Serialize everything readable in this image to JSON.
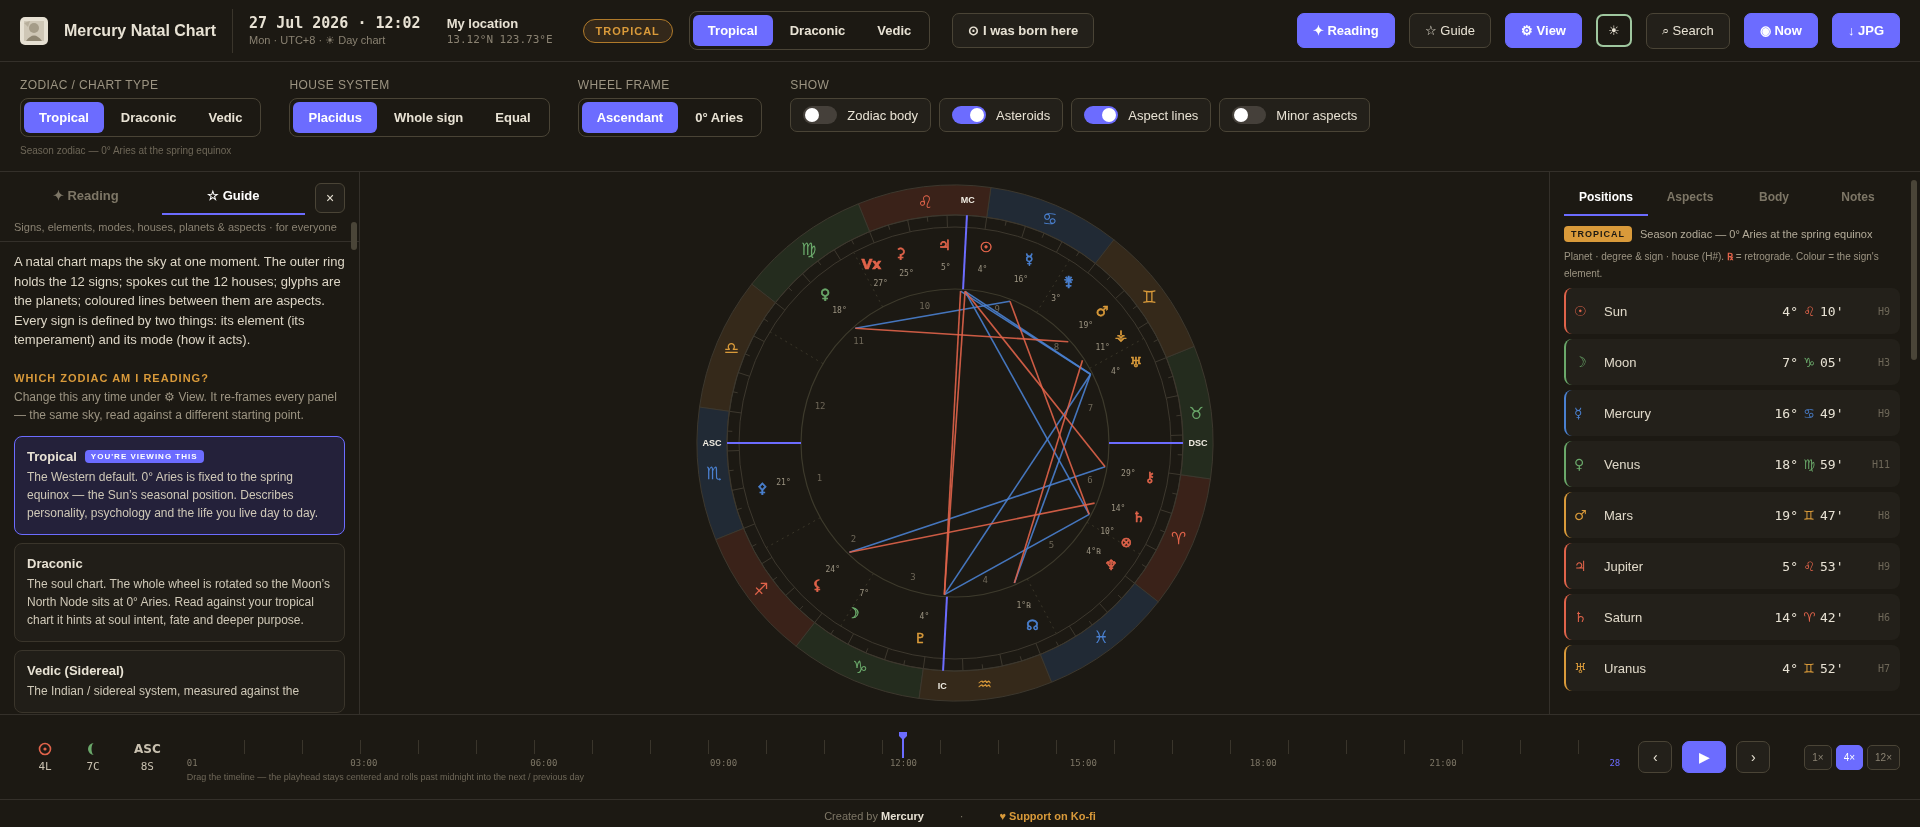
{
  "header": {
    "title": "Mercury Natal Chart",
    "date": "27 Jul 2026 · 12:02",
    "date_sub": "Mon · UTC+8 · ☀ Day chart",
    "location_label": "My location",
    "coords": "13.12°N 123.73°E",
    "zodiac_badge": "TROPICAL",
    "zodiac_tabs": [
      {
        "label": "Tropical",
        "selected": true
      },
      {
        "label": "Draconic",
        "selected": false
      },
      {
        "label": "Vedic",
        "selected": false
      }
    ],
    "born_button": "⊙ I was born here",
    "actions": [
      {
        "label": "✦ Reading",
        "kind": "primary"
      },
      {
        "label": "☆ Guide",
        "kind": "plain"
      },
      {
        "label": "⚙ View",
        "kind": "primary"
      },
      {
        "label": "☀",
        "kind": "theme"
      },
      {
        "label": "⌕ Search",
        "kind": "plain"
      },
      {
        "label": "◉ Now",
        "kind": "primary"
      },
      {
        "label": "↓ JPG",
        "kind": "primary"
      }
    ]
  },
  "settings": {
    "groups": [
      {
        "label": "ZODIAC / CHART TYPE",
        "options": [
          {
            "label": "Tropical",
            "selected": true
          },
          {
            "label": "Draconic",
            "selected": false
          },
          {
            "label": "Vedic",
            "selected": false
          }
        ],
        "note": "Season zodiac — 0° Aries at the spring equinox"
      },
      {
        "label": "HOUSE SYSTEM",
        "options": [
          {
            "label": "Placidus",
            "selected": true
          },
          {
            "label": "Whole sign",
            "selected": false
          },
          {
            "label": "Equal",
            "selected": false
          }
        ]
      },
      {
        "label": "WHEEL FRAME",
        "options": [
          {
            "label": "Ascendant",
            "selected": true
          },
          {
            "label": "0° Aries",
            "selected": false
          }
        ]
      }
    ],
    "show": {
      "label": "SHOW",
      "toggles": [
        {
          "label": "Zodiac body",
          "on": false
        },
        {
          "label": "Asteroids",
          "on": true
        },
        {
          "label": "Aspect lines",
          "on": true
        },
        {
          "label": "Minor aspects",
          "on": false
        }
      ]
    }
  },
  "guide_panel": {
    "tabs": [
      {
        "label": "✦ Reading",
        "selected": false
      },
      {
        "label": "☆ Guide",
        "selected": true
      }
    ],
    "close": "×",
    "subtitle": "Signs, elements, modes, houses, planets & aspects · for everyone",
    "intro": "A natal chart maps the sky at one moment. The outer ring holds the 12 signs; spokes cut the 12 houses; glyphs are the planets; coloured lines between them are aspects. Every sign is defined by two things: its element (its temperament) and its mode (how it acts).",
    "heading": "WHICH ZODIAC AM I READING?",
    "lead": "Change this any time under ⚙ View. It re-frames every panel — the same sky, read against a different starting point.",
    "cards": [
      {
        "title": "Tropical",
        "badge": "YOU'RE VIEWING THIS",
        "selected": true,
        "text": "The Western default. 0° Aries is fixed to the spring equinox — the Sun’s seasonal position. Describes personality, psychology and the life you live day to day."
      },
      {
        "title": "Draconic",
        "selected": false,
        "text": "The soul chart. The whole wheel is rotated so the Moon’s North Node sits at 0° Aries. Read against your tropical chart it hints at soul intent, fate and deeper purpose."
      },
      {
        "title": "Vedic (Sidereal)",
        "selected": false,
        "text": "The Indian / sidereal system, measured against the"
      }
    ]
  },
  "chart": {
    "signs": [
      {
        "glyph": "♈",
        "color": "#e0634a"
      },
      {
        "glyph": "♉",
        "color": "#6aa86a"
      },
      {
        "glyph": "♊",
        "color": "#d99a3a"
      },
      {
        "glyph": "♋",
        "color": "#4a80d0"
      },
      {
        "glyph": "♌",
        "color": "#e0634a"
      },
      {
        "glyph": "♍",
        "color": "#6aa86a"
      },
      {
        "glyph": "♎",
        "color": "#d99a3a"
      },
      {
        "glyph": "♏",
        "color": "#4a80d0"
      },
      {
        "glyph": "♐",
        "color": "#e0634a"
      },
      {
        "glyph": "♑",
        "color": "#6aa86a"
      },
      {
        "glyph": "♒",
        "color": "#d99a3a"
      },
      {
        "glyph": "♓",
        "color": "#4a80d0"
      }
    ],
    "angles": [
      "ASC",
      "MC",
      "DSC",
      "IC"
    ],
    "houses": [
      "1",
      "2",
      "3",
      "4",
      "5",
      "6",
      "7",
      "8",
      "9",
      "10",
      "11",
      "12"
    ],
    "points": [
      {
        "glyph": "♃",
        "degree": "5°",
        "color": "#e0634a"
      },
      {
        "glyph": "☉",
        "degree": "4°",
        "color": "#e0634a"
      },
      {
        "glyph": "☿",
        "degree": "16°",
        "color": "#4a80d0"
      },
      {
        "glyph": "⚵",
        "degree": "3°",
        "color": "#4a80d0"
      },
      {
        "glyph": "♂",
        "degree": "19°",
        "color": "#d99a3a"
      },
      {
        "glyph": "⚶",
        "degree": "11°",
        "color": "#d99a3a"
      },
      {
        "glyph": "♅",
        "degree": "4°",
        "color": "#d99a3a"
      },
      {
        "glyph": "⚷",
        "degree": "29°",
        "color": "#e0634a"
      },
      {
        "glyph": "♄",
        "degree": "14°",
        "color": "#e0634a"
      },
      {
        "glyph": "⊗",
        "degree": "10°",
        "color": "#e0634a"
      },
      {
        "glyph": "♆",
        "degree": "4°℞",
        "color": "#e0634a"
      },
      {
        "glyph": "☊",
        "degree": "1°℞",
        "color": "#4a80d0"
      },
      {
        "glyph": "♇",
        "degree": "4°",
        "color": "#d99a3a"
      },
      {
        "glyph": "☽",
        "degree": "7°",
        "color": "#6aa86a"
      },
      {
        "glyph": "⚸",
        "degree": "24°",
        "color": "#e0634a"
      },
      {
        "glyph": "⚴",
        "degree": "21°",
        "color": "#4a80d0"
      },
      {
        "glyph": "♀",
        "degree": "18°",
        "color": "#6aa86a"
      },
      {
        "glyph": "⚳",
        "degree": "25°",
        "color": "#e0634a"
      },
      {
        "glyph": "Vx",
        "degree": "27°",
        "color": "#e0634a"
      }
    ]
  },
  "positions_panel": {
    "tabs": [
      {
        "label": "Positions",
        "selected": true
      },
      {
        "label": "Aspects",
        "selected": false
      },
      {
        "label": "Body",
        "selected": false
      },
      {
        "label": "Notes",
        "selected": false
      }
    ],
    "badge": "TROPICAL",
    "badge_note": "Season zodiac — 0° Aries at the spring equinox",
    "legend": "Planet · degree & sign · house (H#). **℞** = retrograde. Colour = the sign's element.",
    "rows": [
      {
        "glyph": "☉",
        "name": "Sun",
        "degree": "4°",
        "sign": "♌",
        "minutes": "10'",
        "house": "H9",
        "color": "#e0634a"
      },
      {
        "glyph": "☽",
        "name": "Moon",
        "degree": "7°",
        "sign": "♑",
        "minutes": "05'",
        "house": "H3",
        "color": "#6aa86a"
      },
      {
        "glyph": "☿",
        "name": "Mercury",
        "degree": "16°",
        "sign": "♋",
        "minutes": "49'",
        "house": "H9",
        "color": "#4a80d0"
      },
      {
        "glyph": "♀",
        "name": "Venus",
        "degree": "18°",
        "sign": "♍",
        "minutes": "59'",
        "house": "H11",
        "color": "#6aa86a"
      },
      {
        "glyph": "♂",
        "name": "Mars",
        "degree": "19°",
        "sign": "♊",
        "minutes": "47'",
        "house": "H8",
        "color": "#d99a3a"
      },
      {
        "glyph": "♃",
        "name": "Jupiter",
        "degree": "5°",
        "sign": "♌",
        "minutes": "53'",
        "house": "H9",
        "color": "#e0634a"
      },
      {
        "glyph": "♄",
        "name": "Saturn",
        "degree": "14°",
        "sign": "♈",
        "minutes": "42'",
        "house": "H6",
        "color": "#e0634a"
      },
      {
        "glyph": "♅",
        "name": "Uranus",
        "degree": "4°",
        "sign": "♊",
        "minutes": "52'",
        "house": "H7",
        "color": "#d99a3a"
      }
    ]
  },
  "timeline": {
    "readouts": [
      {
        "kind": "sun",
        "value": "4L",
        "color": "#e0634a"
      },
      {
        "kind": "moon",
        "value": "7C",
        "color": "#6aa86a"
      },
      {
        "kind": "text",
        "label": "ASC",
        "value": "8S"
      }
    ],
    "labels": [
      "01",
      "03:00",
      "06:00",
      "09:00",
      "12:00",
      "15:00",
      "18:00",
      "21:00",
      "28"
    ],
    "hint": "Drag the timeline — the playhead stays centered and rolls past midnight into the next / previous day",
    "nav": [
      "‹",
      "▶",
      "›"
    ],
    "speeds": [
      {
        "label": "1×",
        "selected": false
      },
      {
        "label": "4×",
        "selected": true
      },
      {
        "label": "12×",
        "selected": false
      }
    ]
  },
  "footer": {
    "credit": "Created by **Mercury**",
    "separator": "·",
    "link": "♥ Support on Ko-fi"
  }
}
